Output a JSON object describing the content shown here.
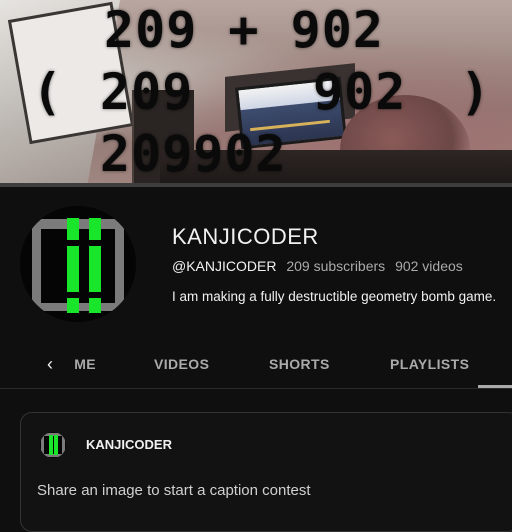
{
  "banner": {
    "line1": "209 + 902",
    "line2_open": "(",
    "line2_a": "209",
    "line2_b": "902",
    "line2_close": ")",
    "line3": "209902"
  },
  "channel": {
    "name": "KANJICODER",
    "handle": "@KANJICODER",
    "subscribers": "209 subscribers",
    "videos": "902 videos",
    "description": "I am making a fully destructible geometry bomb game.",
    "avatar_icon": "green-bars-logo-icon",
    "accent_color": "#19e52b"
  },
  "tabs": {
    "prev_icon": "chevron-left-icon",
    "prev_symbol": "‹",
    "items": [
      {
        "label": "HOME",
        "visible_label": "ME"
      },
      {
        "label": "VIDEOS"
      },
      {
        "label": "SHORTS"
      },
      {
        "label": "PLAYLISTS"
      }
    ]
  },
  "post": {
    "author": "KANJICODER",
    "placeholder": "Share an image to start a caption contest"
  }
}
